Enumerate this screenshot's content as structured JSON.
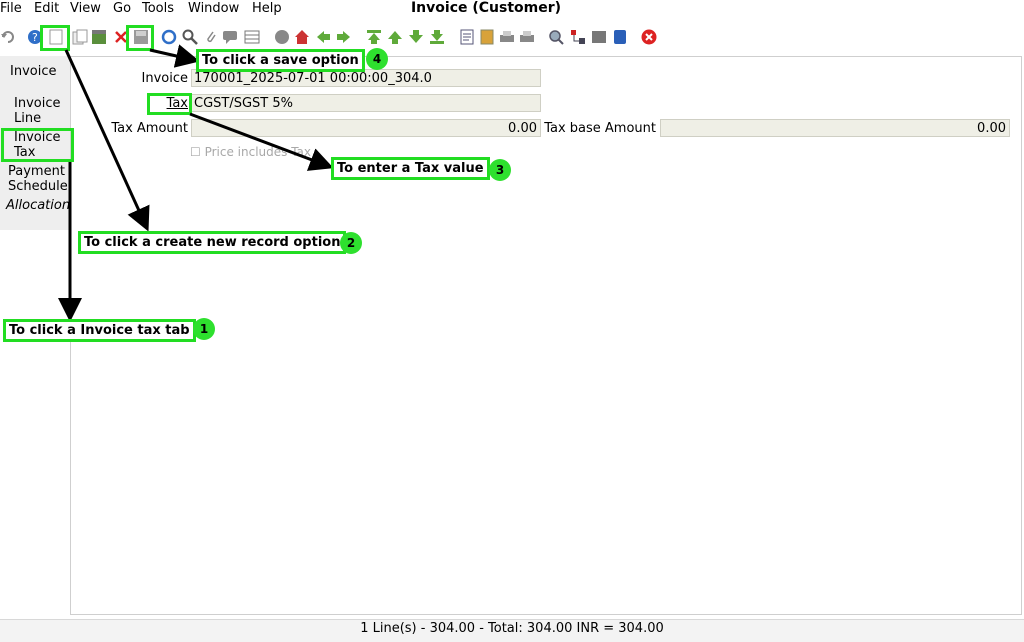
{
  "menu": {
    "items": [
      {
        "label": "File"
      },
      {
        "label": "Edit"
      },
      {
        "label": "View"
      },
      {
        "label": "Go"
      },
      {
        "label": "Tools"
      },
      {
        "label": "Window"
      },
      {
        "label": "Help"
      }
    ]
  },
  "window_title": "Invoice (Customer)",
  "sidebar": {
    "tabs": [
      {
        "label": "Invoice"
      },
      {
        "label": "Invoice Line"
      },
      {
        "label": "Invoice Tax"
      },
      {
        "label": "Payment Schedule"
      },
      {
        "label": "Allocation"
      }
    ]
  },
  "form": {
    "invoice_label": "Invoice",
    "invoice_value": "170001_2025-07-01 00:00:00_304.0",
    "tax_label": "Tax",
    "tax_value": "CGST/SGST 5%",
    "tax_amount_label": "Tax Amount",
    "tax_amount_value": "0.00",
    "tax_base_label": "Tax base Amount",
    "tax_base_value": "0.00",
    "price_includes_tax_label": "Price includes Tax"
  },
  "status": {
    "text": "1 Line(s) - 304.00 -  Total: 304.00  INR  =  304.00"
  },
  "annotations": [
    {
      "text": "To click a save option",
      "number": "4"
    },
    {
      "text": "To enter a Tax value",
      "number": "3"
    },
    {
      "text": "To click a create new record option",
      "number": "2"
    },
    {
      "text": "To click a Invoice tax tab",
      "number": "1"
    }
  ],
  "colors": {
    "highlight": "#22dd22",
    "field_bg": "#efefe6"
  }
}
